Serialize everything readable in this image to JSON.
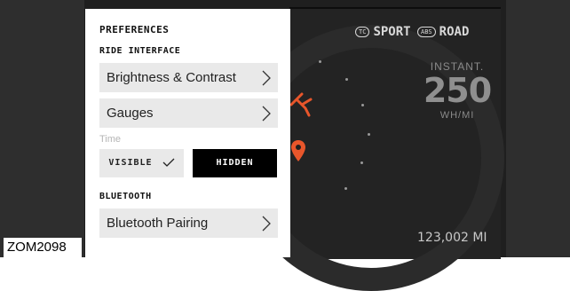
{
  "figure_code": "ZOM2098",
  "preferences": {
    "title": "PREFERENCES",
    "ride_interface_header": "RIDE INTERFACE",
    "items": [
      {
        "label": "Brightness & Contrast"
      },
      {
        "label": "Gauges"
      }
    ],
    "time_label": "Time",
    "visibility_toggle": {
      "visible_label": "VISIBLE",
      "hidden_label": "HIDDEN",
      "selected": "hidden"
    },
    "bluetooth_header": "BLUETOOTH",
    "bluetooth_item": {
      "label": "Bluetooth Pairing"
    }
  },
  "dashboard": {
    "traction_badge": "TC",
    "mode": "SPORT",
    "abs_badge": "ABS",
    "road": "ROAD",
    "instant_label": "INSTANT.",
    "instant_value": "250",
    "instant_unit": "WH/MI",
    "odometer": "123,002 MI"
  },
  "colors": {
    "accent_orange": "#e8562b",
    "panel_background": "#ffffff",
    "row_background": "#e9e9e9",
    "dashboard_background": "#1f1f1f"
  }
}
